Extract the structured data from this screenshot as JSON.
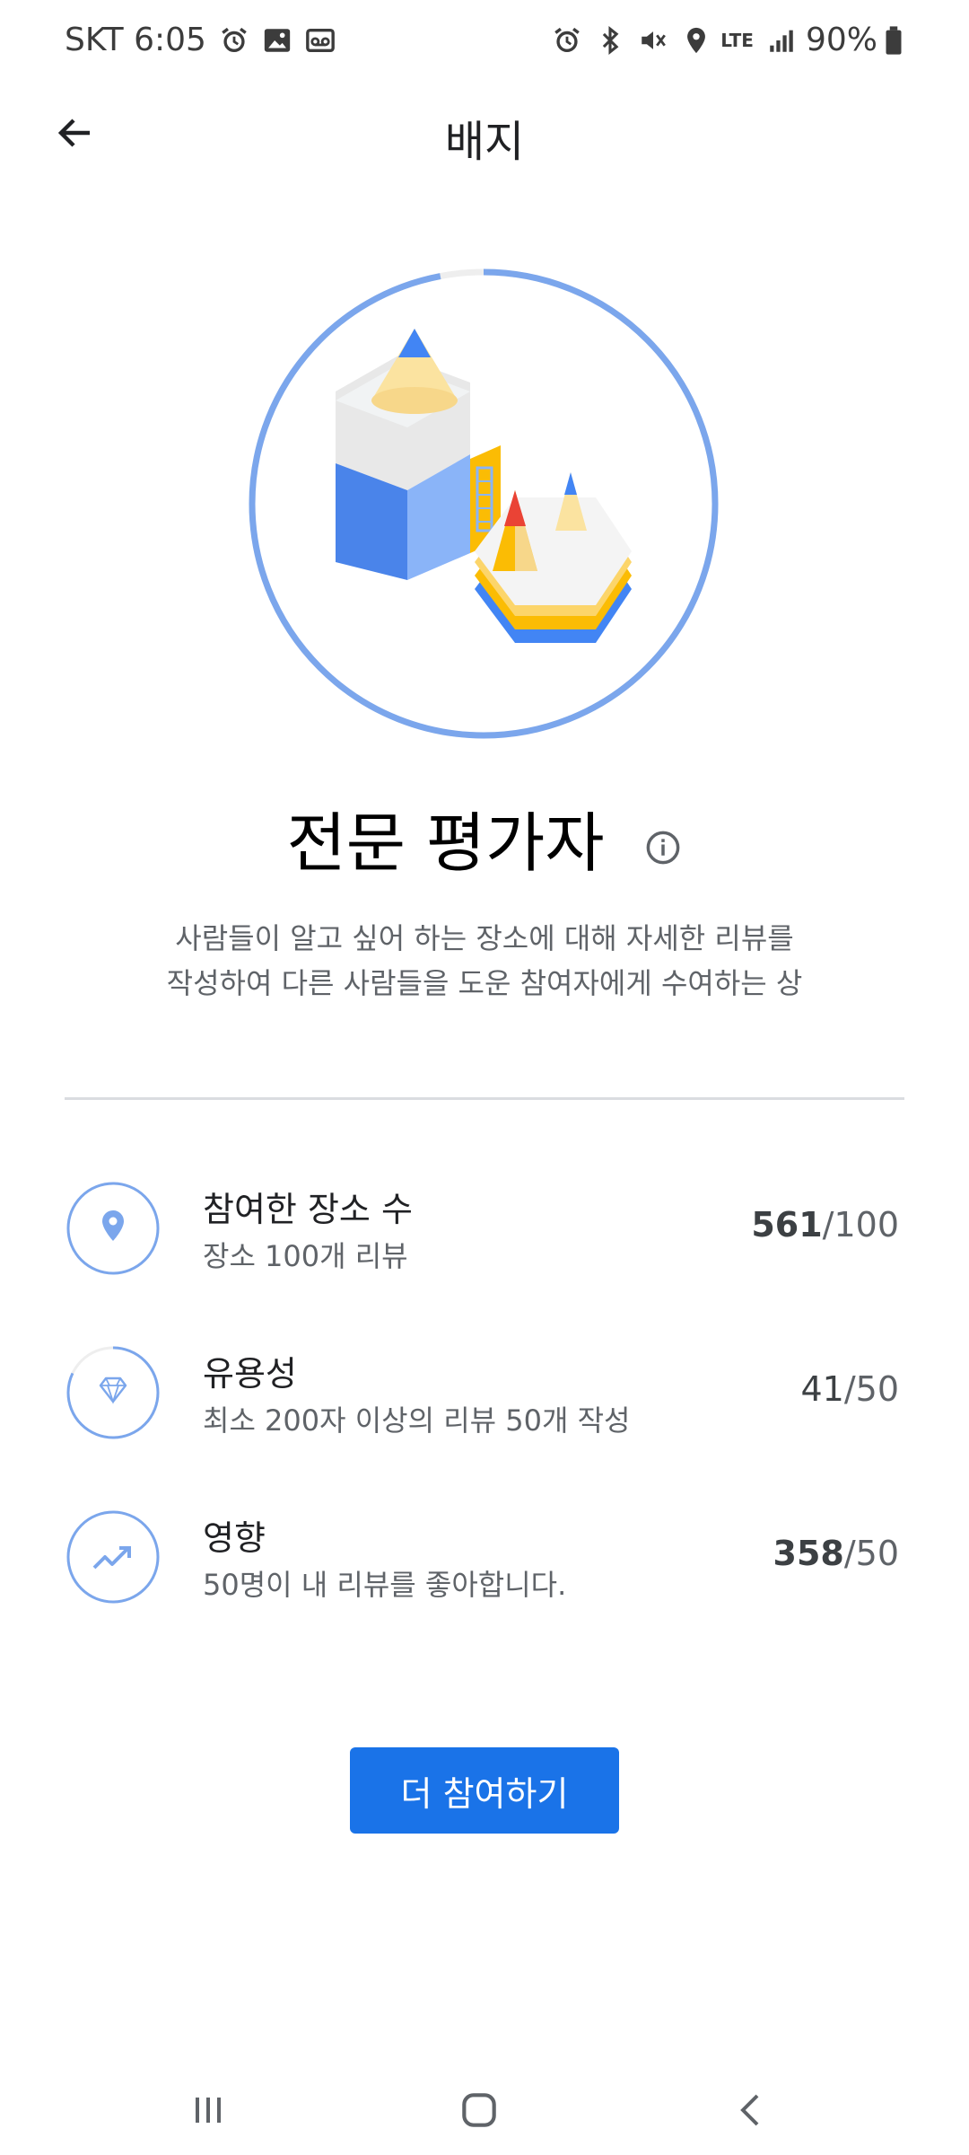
{
  "status_bar": {
    "carrier_time": "SKT 6:05",
    "network": "LTE",
    "battery": "90%",
    "left_icons": [
      "alarm-icon",
      "gallery-icon",
      "voicemail-icon"
    ],
    "right_icons": [
      "alarm-icon",
      "bluetooth-icon",
      "mute-icon",
      "location-icon",
      "signal-icon",
      "battery-icon"
    ]
  },
  "app_bar": {
    "title": "배지",
    "back_icon": "arrow-back-icon"
  },
  "badge": {
    "name": "전문 평가자",
    "description_line1": "사람들이 알고 싶어 하는 장소에 대해 자세한 리뷰를",
    "description_line2": "작성하여 다른 사람들을 도운 참여자에게 수여하는 상",
    "ring_progress": 0.97,
    "colors": {
      "ring": "#7ba6ec",
      "ring_track": "#eeeeee",
      "blue": "#4285f4",
      "yellow": "#fbbc04",
      "red": "#ea4335"
    }
  },
  "stats": [
    {
      "icon": "location-pin-icon",
      "title": "참여한 장소 수",
      "subtitle": "장소 100개 리뷰",
      "current": "561",
      "target": "/100",
      "progress": 1.0
    },
    {
      "icon": "diamond-icon",
      "title": "유용성",
      "subtitle": "최소 200자 이상의 리뷰 50개 작성",
      "current": "41",
      "target": "/50",
      "progress": 0.82
    },
    {
      "icon": "trending-up-icon",
      "title": "영향",
      "subtitle": "50명이 내 리뷰를 좋아합니다.",
      "current": "358",
      "target": "/50",
      "progress": 1.0
    }
  ],
  "cta": {
    "label": "더 참여하기",
    "color": "#1a73e8"
  },
  "nav_bar": {
    "icons": [
      "recent-apps-icon",
      "home-icon",
      "back-icon"
    ]
  }
}
